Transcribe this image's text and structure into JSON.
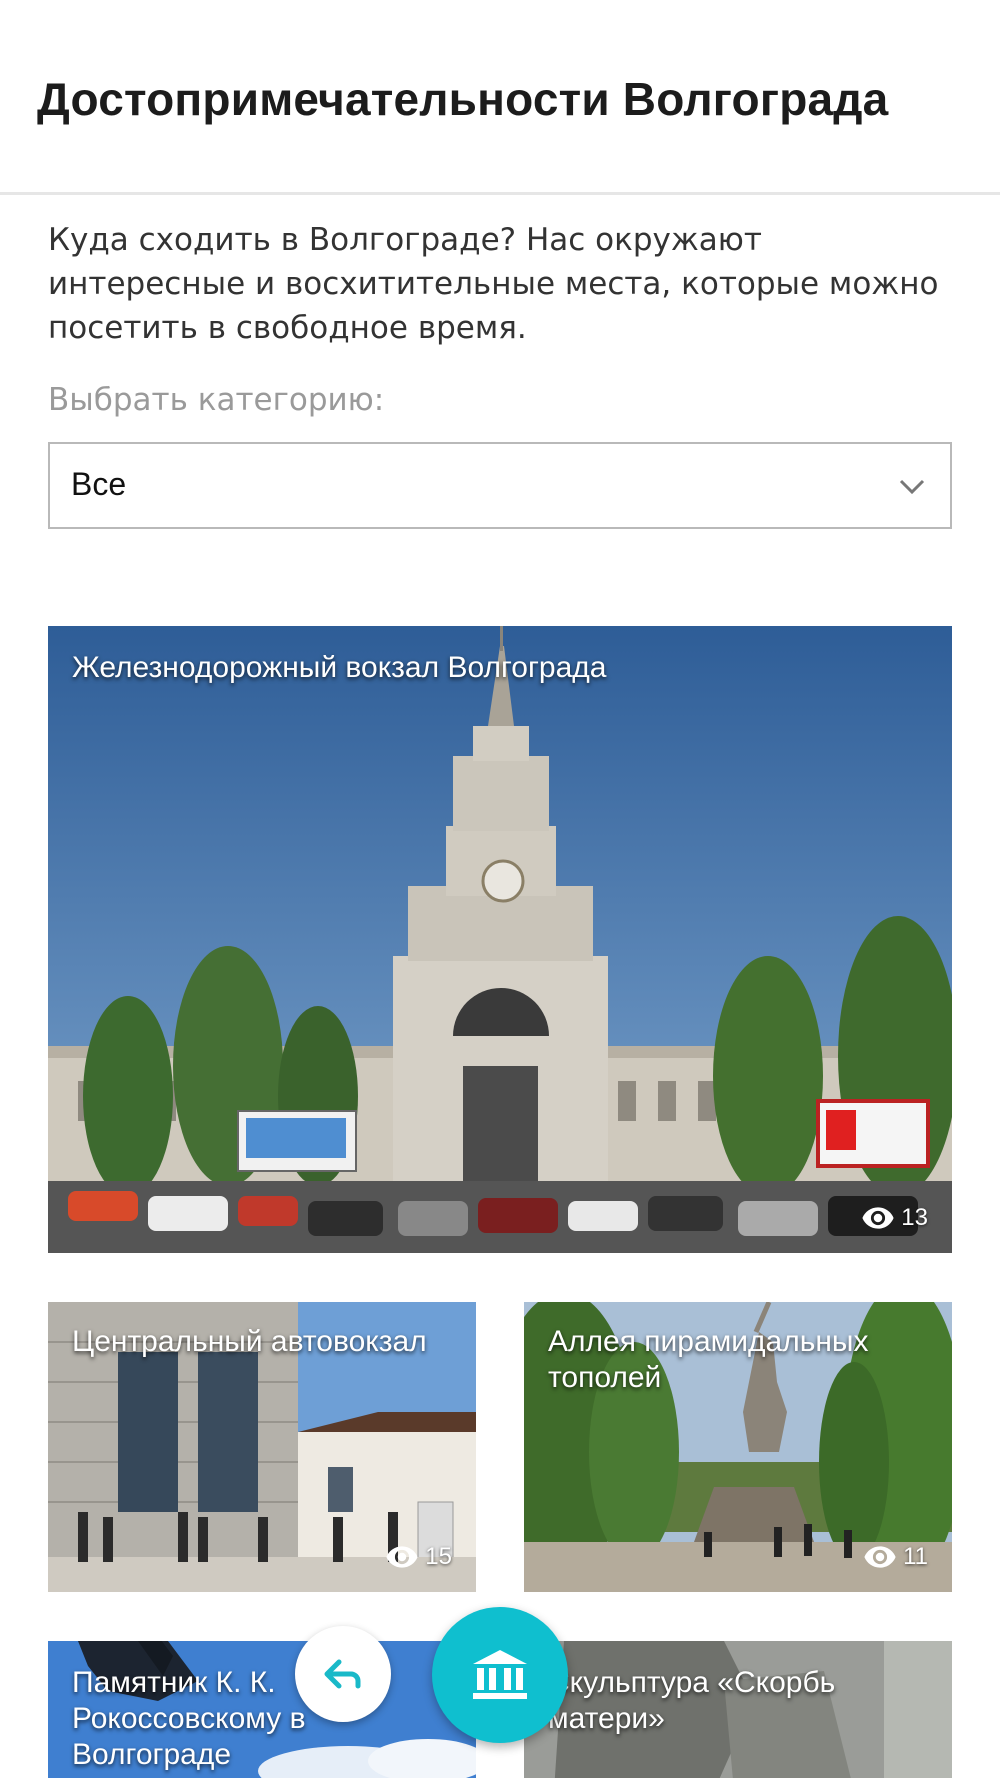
{
  "header": {
    "title": "Достопримечательности Волгограда"
  },
  "intro": {
    "text": "Куда сходить в Волгограде? Нас окружают интересные и восхитительные места, которые можно посетить в свободное время."
  },
  "filter": {
    "label": "Выбрать категорию:",
    "selected": "Все"
  },
  "cards": [
    {
      "title": "Железнодорожный вокзал Волгограда",
      "views": "13"
    },
    {
      "title": "Центральный автовокзал",
      "views": "15"
    },
    {
      "title": "Аллея пирамидальных тополей",
      "views": "11"
    },
    {
      "title": "Памятник К. К. Рокоссовскому в Волгограде",
      "views": ""
    },
    {
      "title": "Скульптура «Скорбь матери»",
      "views": ""
    }
  ],
  "icons": {
    "back": "reply-arrow-icon",
    "main": "museum-icon",
    "views": "eye-icon",
    "select": "chevron-down-icon"
  },
  "colors": {
    "accent": "#0fbfcf",
    "back_arrow": "#19b9c8"
  }
}
